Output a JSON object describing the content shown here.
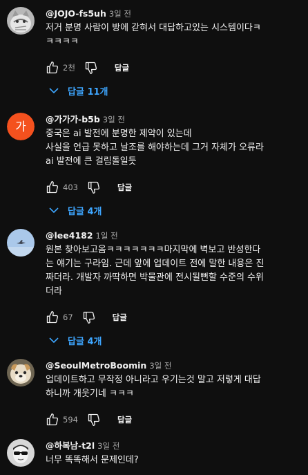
{
  "ui": {
    "reply_label": "답글"
  },
  "comments": [
    {
      "author": "@JOJO-fs5uh",
      "time": "3일 전",
      "lines": [
        "저거 분명 사람이 방에 갇혀서 대답하고있는 시스템이다ㅋ",
        "ㅋㅋㅋㅋ"
      ],
      "likes": "2천",
      "replies": "답글 11개",
      "avatar": {
        "type": "photo",
        "icon": "cat-photo"
      }
    },
    {
      "author": "@가가가-b5b",
      "time": "3일 전",
      "lines": [
        "중국은 ai 발전에 분명한 제약이 있는데",
        "사실을 언급 못하고 날조를 해야하는데 그거 자체가 오류라",
        "ai 발전에 큰 걸림돌일듯"
      ],
      "likes": "403",
      "replies": "답글 4개",
      "avatar": {
        "type": "letter",
        "letter": "가",
        "color": "#f4511e"
      }
    },
    {
      "author": "@lee4182",
      "time": "1일 전",
      "lines": [
        "원본 찾아보고옴ㅋㅋㅋㅋㅋㅋㅋ마지막에 벽보고 반성한다",
        "는 얘기는 구라임. 근데 앞에 업데이트 전에 말한 내용은 진",
        "짜더라. 개발자 까딱하면 박물관에 전시될뻔할 수준의 수위",
        "더라"
      ],
      "likes": "67",
      "replies": "답글 4개",
      "avatar": {
        "type": "photo",
        "icon": "sky-photo"
      }
    },
    {
      "author": "@SeoulMetroBoomin",
      "time": "3일 전",
      "lines": [
        "업데이트하고 무작정 아니라고 우기는것 말고 저렇게 대답",
        "하니까 개웃기네 ㅋㅋㅋ"
      ],
      "likes": "594",
      "replies": "",
      "avatar": {
        "type": "photo",
        "icon": "dog-photo"
      }
    },
    {
      "author": "@하복남-t2l",
      "time": "3일 전",
      "lines": [
        "너무 똑똑해서 문제인데?"
      ],
      "likes": "",
      "replies": "",
      "avatar": {
        "type": "photo",
        "icon": "sunglasses-face-photo"
      }
    }
  ]
}
